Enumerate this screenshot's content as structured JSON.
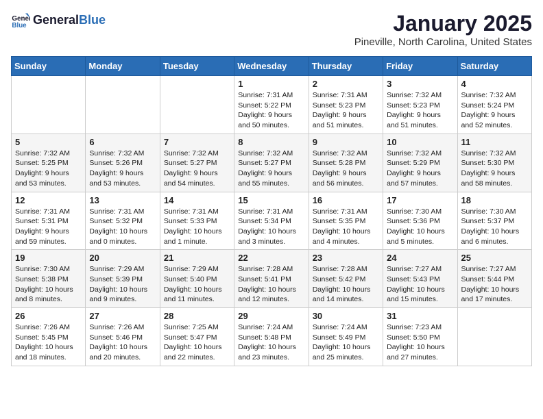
{
  "header": {
    "logo_line1": "General",
    "logo_line2": "Blue",
    "month": "January 2025",
    "location": "Pineville, North Carolina, United States"
  },
  "weekdays": [
    "Sunday",
    "Monday",
    "Tuesday",
    "Wednesday",
    "Thursday",
    "Friday",
    "Saturday"
  ],
  "weeks": [
    [
      {
        "day": "",
        "info": ""
      },
      {
        "day": "",
        "info": ""
      },
      {
        "day": "",
        "info": ""
      },
      {
        "day": "1",
        "info": "Sunrise: 7:31 AM\nSunset: 5:22 PM\nDaylight: 9 hours\nand 50 minutes."
      },
      {
        "day": "2",
        "info": "Sunrise: 7:31 AM\nSunset: 5:23 PM\nDaylight: 9 hours\nand 51 minutes."
      },
      {
        "day": "3",
        "info": "Sunrise: 7:32 AM\nSunset: 5:23 PM\nDaylight: 9 hours\nand 51 minutes."
      },
      {
        "day": "4",
        "info": "Sunrise: 7:32 AM\nSunset: 5:24 PM\nDaylight: 9 hours\nand 52 minutes."
      }
    ],
    [
      {
        "day": "5",
        "info": "Sunrise: 7:32 AM\nSunset: 5:25 PM\nDaylight: 9 hours\nand 53 minutes."
      },
      {
        "day": "6",
        "info": "Sunrise: 7:32 AM\nSunset: 5:26 PM\nDaylight: 9 hours\nand 53 minutes."
      },
      {
        "day": "7",
        "info": "Sunrise: 7:32 AM\nSunset: 5:27 PM\nDaylight: 9 hours\nand 54 minutes."
      },
      {
        "day": "8",
        "info": "Sunrise: 7:32 AM\nSunset: 5:27 PM\nDaylight: 9 hours\nand 55 minutes."
      },
      {
        "day": "9",
        "info": "Sunrise: 7:32 AM\nSunset: 5:28 PM\nDaylight: 9 hours\nand 56 minutes."
      },
      {
        "day": "10",
        "info": "Sunrise: 7:32 AM\nSunset: 5:29 PM\nDaylight: 9 hours\nand 57 minutes."
      },
      {
        "day": "11",
        "info": "Sunrise: 7:32 AM\nSunset: 5:30 PM\nDaylight: 9 hours\nand 58 minutes."
      }
    ],
    [
      {
        "day": "12",
        "info": "Sunrise: 7:31 AM\nSunset: 5:31 PM\nDaylight: 9 hours\nand 59 minutes."
      },
      {
        "day": "13",
        "info": "Sunrise: 7:31 AM\nSunset: 5:32 PM\nDaylight: 10 hours\nand 0 minutes."
      },
      {
        "day": "14",
        "info": "Sunrise: 7:31 AM\nSunset: 5:33 PM\nDaylight: 10 hours\nand 1 minute."
      },
      {
        "day": "15",
        "info": "Sunrise: 7:31 AM\nSunset: 5:34 PM\nDaylight: 10 hours\nand 3 minutes."
      },
      {
        "day": "16",
        "info": "Sunrise: 7:31 AM\nSunset: 5:35 PM\nDaylight: 10 hours\nand 4 minutes."
      },
      {
        "day": "17",
        "info": "Sunrise: 7:30 AM\nSunset: 5:36 PM\nDaylight: 10 hours\nand 5 minutes."
      },
      {
        "day": "18",
        "info": "Sunrise: 7:30 AM\nSunset: 5:37 PM\nDaylight: 10 hours\nand 6 minutes."
      }
    ],
    [
      {
        "day": "19",
        "info": "Sunrise: 7:30 AM\nSunset: 5:38 PM\nDaylight: 10 hours\nand 8 minutes."
      },
      {
        "day": "20",
        "info": "Sunrise: 7:29 AM\nSunset: 5:39 PM\nDaylight: 10 hours\nand 9 minutes."
      },
      {
        "day": "21",
        "info": "Sunrise: 7:29 AM\nSunset: 5:40 PM\nDaylight: 10 hours\nand 11 minutes."
      },
      {
        "day": "22",
        "info": "Sunrise: 7:28 AM\nSunset: 5:41 PM\nDaylight: 10 hours\nand 12 minutes."
      },
      {
        "day": "23",
        "info": "Sunrise: 7:28 AM\nSunset: 5:42 PM\nDaylight: 10 hours\nand 14 minutes."
      },
      {
        "day": "24",
        "info": "Sunrise: 7:27 AM\nSunset: 5:43 PM\nDaylight: 10 hours\nand 15 minutes."
      },
      {
        "day": "25",
        "info": "Sunrise: 7:27 AM\nSunset: 5:44 PM\nDaylight: 10 hours\nand 17 minutes."
      }
    ],
    [
      {
        "day": "26",
        "info": "Sunrise: 7:26 AM\nSunset: 5:45 PM\nDaylight: 10 hours\nand 18 minutes."
      },
      {
        "day": "27",
        "info": "Sunrise: 7:26 AM\nSunset: 5:46 PM\nDaylight: 10 hours\nand 20 minutes."
      },
      {
        "day": "28",
        "info": "Sunrise: 7:25 AM\nSunset: 5:47 PM\nDaylight: 10 hours\nand 22 minutes."
      },
      {
        "day": "29",
        "info": "Sunrise: 7:24 AM\nSunset: 5:48 PM\nDaylight: 10 hours\nand 23 minutes."
      },
      {
        "day": "30",
        "info": "Sunrise: 7:24 AM\nSunset: 5:49 PM\nDaylight: 10 hours\nand 25 minutes."
      },
      {
        "day": "31",
        "info": "Sunrise: 7:23 AM\nSunset: 5:50 PM\nDaylight: 10 hours\nand 27 minutes."
      },
      {
        "day": "",
        "info": ""
      }
    ]
  ]
}
